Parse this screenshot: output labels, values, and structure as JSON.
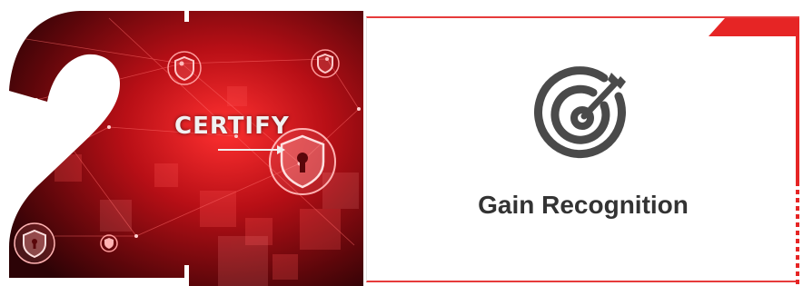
{
  "graphic": {
    "step_number": "2",
    "word": "CERTIFY",
    "accent_color": "#e62525",
    "icons": [
      "shield-lock-icon",
      "shield-icon",
      "arrow-icon"
    ]
  },
  "card": {
    "icon": "target-arrow-icon",
    "title": "Gain Recognition",
    "accent_color": "#e62525",
    "text_color": "#333333"
  }
}
